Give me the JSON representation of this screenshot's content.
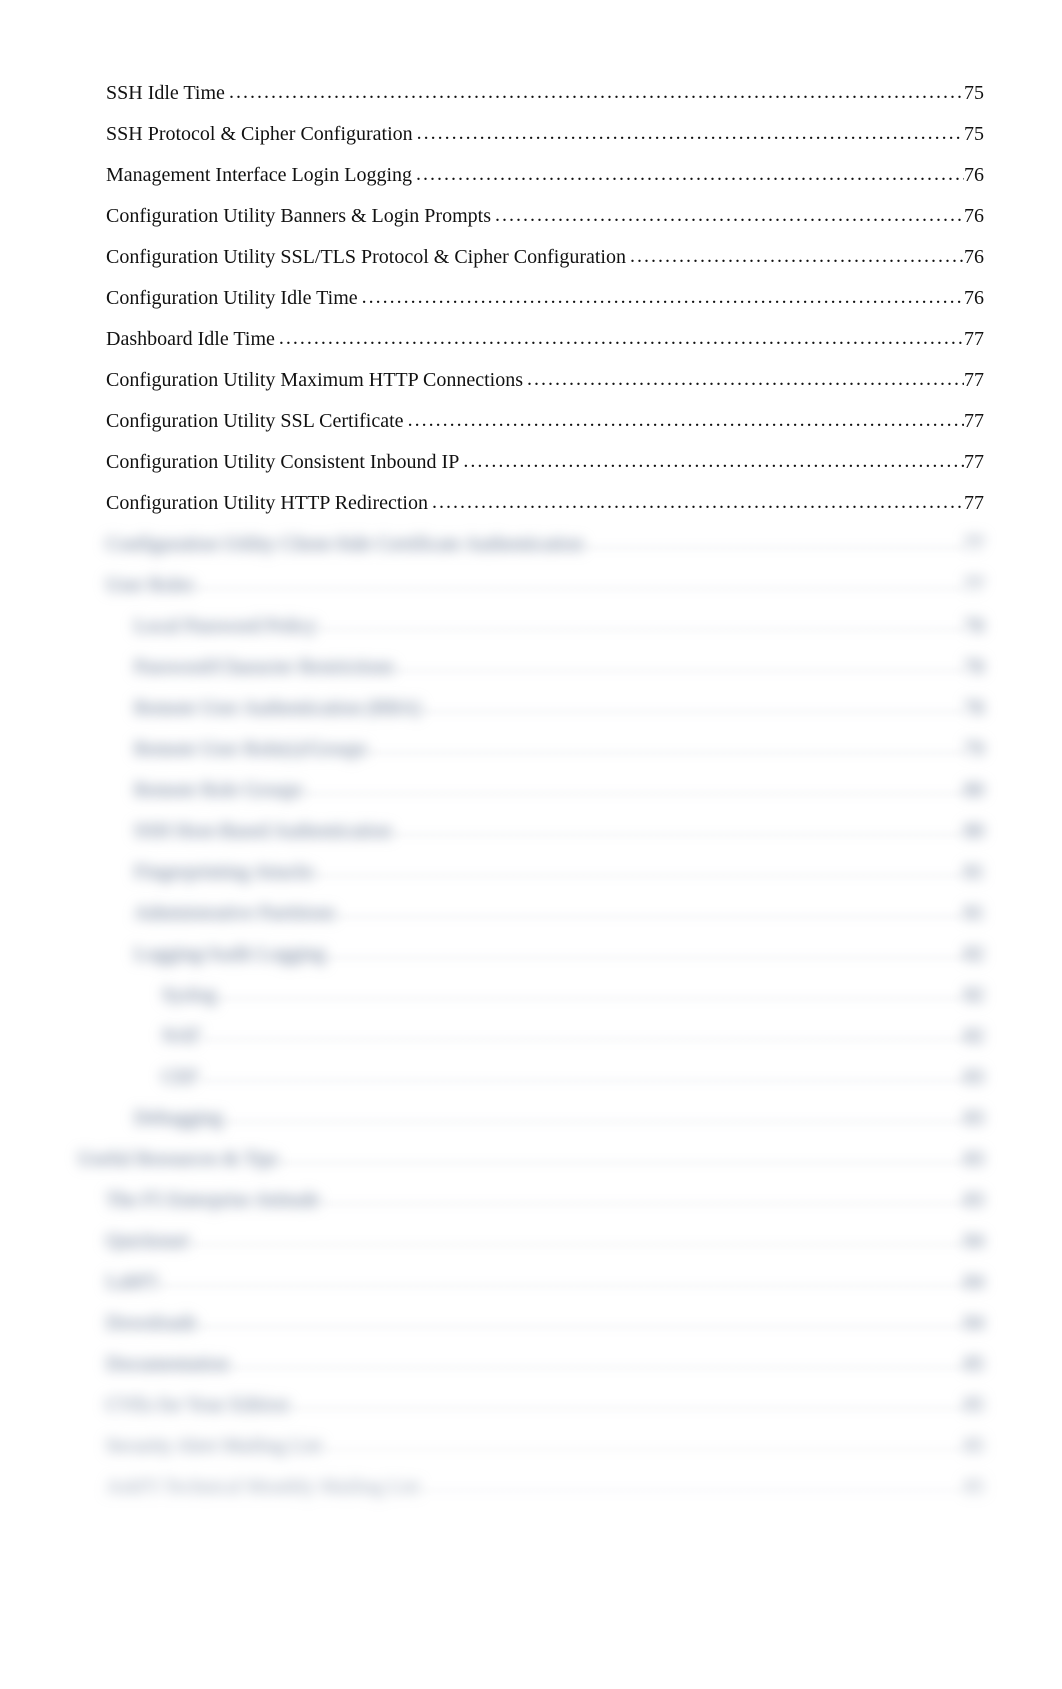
{
  "toc": {
    "entries": [
      {
        "title": "SSH Idle Time",
        "page": "75",
        "indent": 1,
        "blurred": false
      },
      {
        "title": "SSH Protocol & Cipher Configuration",
        "page": "75",
        "indent": 1,
        "blurred": false
      },
      {
        "title": "Management Interface Login Logging",
        "page": "76",
        "indent": 1,
        "blurred": false
      },
      {
        "title": "Configuration Utility Banners & Login Prompts",
        "page": "76",
        "indent": 1,
        "blurred": false
      },
      {
        "title": "Configuration Utility SSL/TLS Protocol & Cipher Configuration",
        "page": "76",
        "indent": 1,
        "blurred": false
      },
      {
        "title": "Configuration Utility Idle Time",
        "page": "76",
        "indent": 1,
        "blurred": false
      },
      {
        "title": "Dashboard Idle Time",
        "page": "77",
        "indent": 1,
        "blurred": false
      },
      {
        "title": "Configuration Utility Maximum HTTP Connections",
        "page": "77",
        "indent": 1,
        "blurred": false
      },
      {
        "title": "Configuration Utility SSL Certificate",
        "page": "77",
        "indent": 1,
        "blurred": false
      },
      {
        "title": "Configuration Utility Consistent Inbound IP",
        "page": "77",
        "indent": 1,
        "blurred": false
      },
      {
        "title": "Configuration Utility HTTP Redirection",
        "page": "77",
        "indent": 1,
        "blurred": false
      },
      {
        "title": "Configuration Utility Client-Side Certificate Authentication",
        "page": "77",
        "indent": 1,
        "blurred": true
      },
      {
        "title": "User Roles",
        "page": "77",
        "indent": 1,
        "blurred": true
      },
      {
        "title": "Local Password Policy",
        "page": "78",
        "indent": 2,
        "blurred": true
      },
      {
        "title": "Password/Character Restrictions",
        "page": "78",
        "indent": 2,
        "blurred": true
      },
      {
        "title": "Remote User Authentication (RBA)",
        "page": "78",
        "indent": 2,
        "blurred": true
      },
      {
        "title": "Remote User Role(s)/Groups",
        "page": "79",
        "indent": 2,
        "blurred": true
      },
      {
        "title": "Remote Role Groups",
        "page": "80",
        "indent": 2,
        "blurred": true
      },
      {
        "title": "SSH Host-Based Authentication",
        "page": "80",
        "indent": 2,
        "blurred": true
      },
      {
        "title": "Fingerprinting Attacks",
        "page": "81",
        "indent": 2,
        "blurred": true
      },
      {
        "title": "Administrative Partitions",
        "page": "81",
        "indent": 2,
        "blurred": true
      },
      {
        "title": "Logging/Audit Logging",
        "page": "82",
        "indent": 2,
        "blurred": true
      },
      {
        "title": "Syslog",
        "page": "82",
        "indent": 3,
        "blurred": true
      },
      {
        "title": "NAT",
        "page": "82",
        "indent": 3,
        "blurred": true
      },
      {
        "title": "CEF",
        "page": "83",
        "indent": 3,
        "blurred": true
      },
      {
        "title": "Debugging",
        "page": "83",
        "indent": 2,
        "blurred": true
      },
      {
        "title": "Useful Resources & Tips",
        "page": "83",
        "indent": 0,
        "blurred": true
      },
      {
        "title": "The F5 Enterprise Attitude",
        "page": "83",
        "indent": 1,
        "blurred": true
      },
      {
        "title": "Quickstart",
        "page": "84",
        "indent": 1,
        "blurred": true
      },
      {
        "title": "LabF5",
        "page": "84",
        "indent": 1,
        "blurred": true
      },
      {
        "title": "Downloads",
        "page": "84",
        "indent": 1,
        "blurred": true
      },
      {
        "title": "Documentation",
        "page": "85",
        "indent": 1,
        "blurred": true
      },
      {
        "title": "CVEs for Your Edition",
        "page": "85",
        "indent": 1,
        "blurred": true
      },
      {
        "title": "Security Alert Mailing List",
        "page": "85",
        "indent": 1,
        "blurred": true
      },
      {
        "title": "AskF5 Technical Monthly Mailing List",
        "page": "85",
        "indent": 1,
        "blurred": true
      }
    ]
  }
}
